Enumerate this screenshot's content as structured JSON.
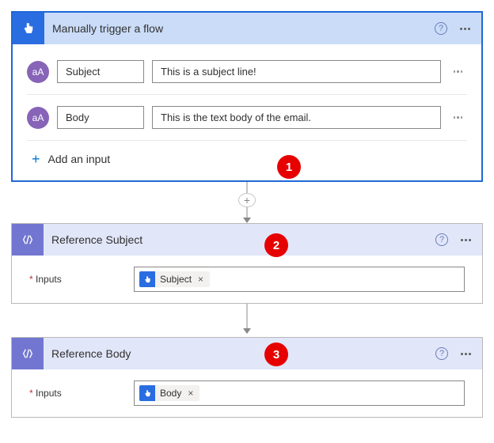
{
  "trigger": {
    "title": "Manually trigger a flow",
    "fields": [
      {
        "name": "Subject",
        "value": "This is a subject line!"
      },
      {
        "name": "Body",
        "value": "This is the text body of the email."
      }
    ],
    "addInputLabel": "Add an input"
  },
  "actions": [
    {
      "title": "Reference Subject",
      "inputsLabel": "Inputs",
      "token": "Subject"
    },
    {
      "title": "Reference Body",
      "inputsLabel": "Inputs",
      "token": "Body"
    }
  ],
  "markers": {
    "one": "1",
    "two": "2",
    "three": "3"
  }
}
